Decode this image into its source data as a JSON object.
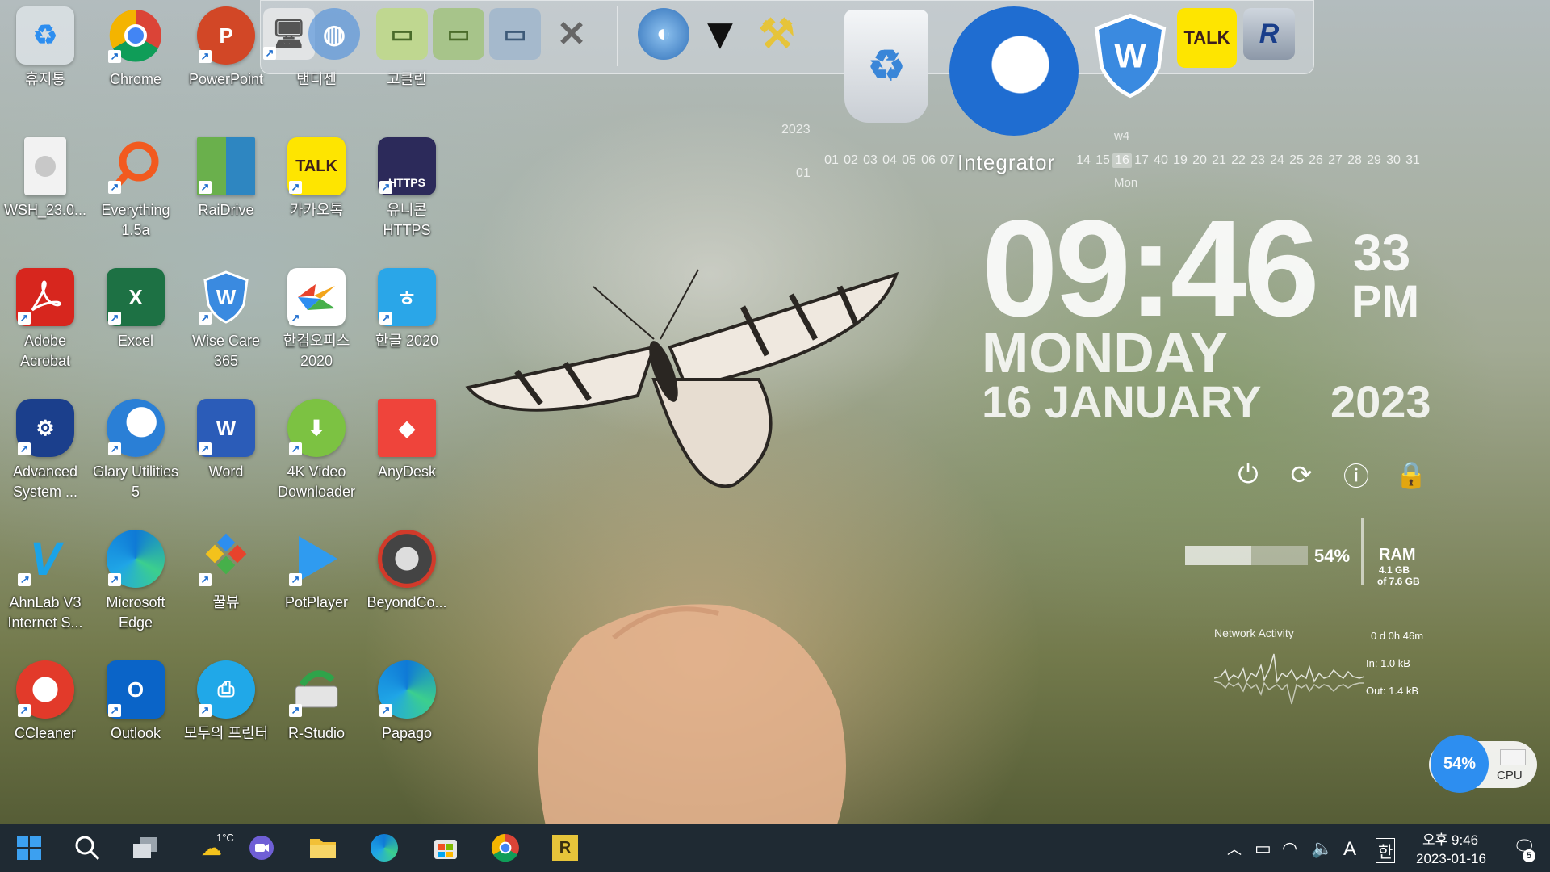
{
  "desktop": {
    "icons": [
      {
        "label": "휴지통"
      },
      {
        "label": "Chrome"
      },
      {
        "label": "PowerPoint"
      },
      {
        "label": "탠디젠"
      },
      {
        "label": "고클린"
      },
      {
        "label": "WSH_23.0..."
      },
      {
        "label": "Everything 1.5a"
      },
      {
        "label": "RaiDrive"
      },
      {
        "label": "카카오톡"
      },
      {
        "label": "유니콘 HTTPS"
      },
      {
        "label": "Adobe Acrobat"
      },
      {
        "label": "Excel"
      },
      {
        "label": "Wise Care 365"
      },
      {
        "label": "한컴오피스 2020"
      },
      {
        "label": "한글 2020"
      },
      {
        "label": "Advanced System ..."
      },
      {
        "label": "Glary Utilities 5"
      },
      {
        "label": "Word"
      },
      {
        "label": "4K Video Downloader"
      },
      {
        "label": "AnyDesk"
      },
      {
        "label": "AhnLab V3 Internet S..."
      },
      {
        "label": "Microsoft Edge"
      },
      {
        "label": "꿀뷰"
      },
      {
        "label": "PotPlayer"
      },
      {
        "label": "BeyondCo..."
      },
      {
        "label": "CCleaner"
      },
      {
        "label": "Outlook"
      },
      {
        "label": "모두의 프린터"
      },
      {
        "label": "R-Studio"
      },
      {
        "label": "Papago"
      }
    ]
  },
  "dock": {
    "talk_label": "TALK",
    "app_label": "Integrator"
  },
  "calendar": {
    "year": "2023",
    "month": "01",
    "week": "w4",
    "weekday": "Mon",
    "days_left": [
      "01",
      "02",
      "03",
      "04",
      "05",
      "06",
      "07"
    ],
    "days_right": [
      "14",
      "15",
      "16",
      "17",
      "40",
      "19",
      "20",
      "21",
      "22",
      "23",
      "24",
      "25",
      "26",
      "27",
      "28",
      "29",
      "30",
      "31"
    ],
    "today": "16"
  },
  "clock": {
    "hm": "09:46",
    "seconds": "33",
    "ampm": "PM",
    "day": "MONDAY",
    "date": "16 JANUARY",
    "year": "2023"
  },
  "ram": {
    "percent_label": "54%",
    "percent": 54,
    "label": "RAM",
    "used": "4.1 GB",
    "total": "of 7.6 GB"
  },
  "network": {
    "title": "Network Activity",
    "uptime": "0 d 0h 46m",
    "in": "In: 1.0 kB",
    "out": "Out: 1.4 kB"
  },
  "cpu": {
    "percent_label": "54%",
    "label": "CPU"
  },
  "taskbar": {
    "weather": "1°C",
    "tray_ime": "A",
    "tray_lang": "한",
    "time": "오후 9:46",
    "date": "2023-01-16",
    "notifications": "5",
    "store_letter": "R"
  },
  "colors": {
    "accent": "#2d8ef0",
    "taskbar": "#1f2a33"
  }
}
